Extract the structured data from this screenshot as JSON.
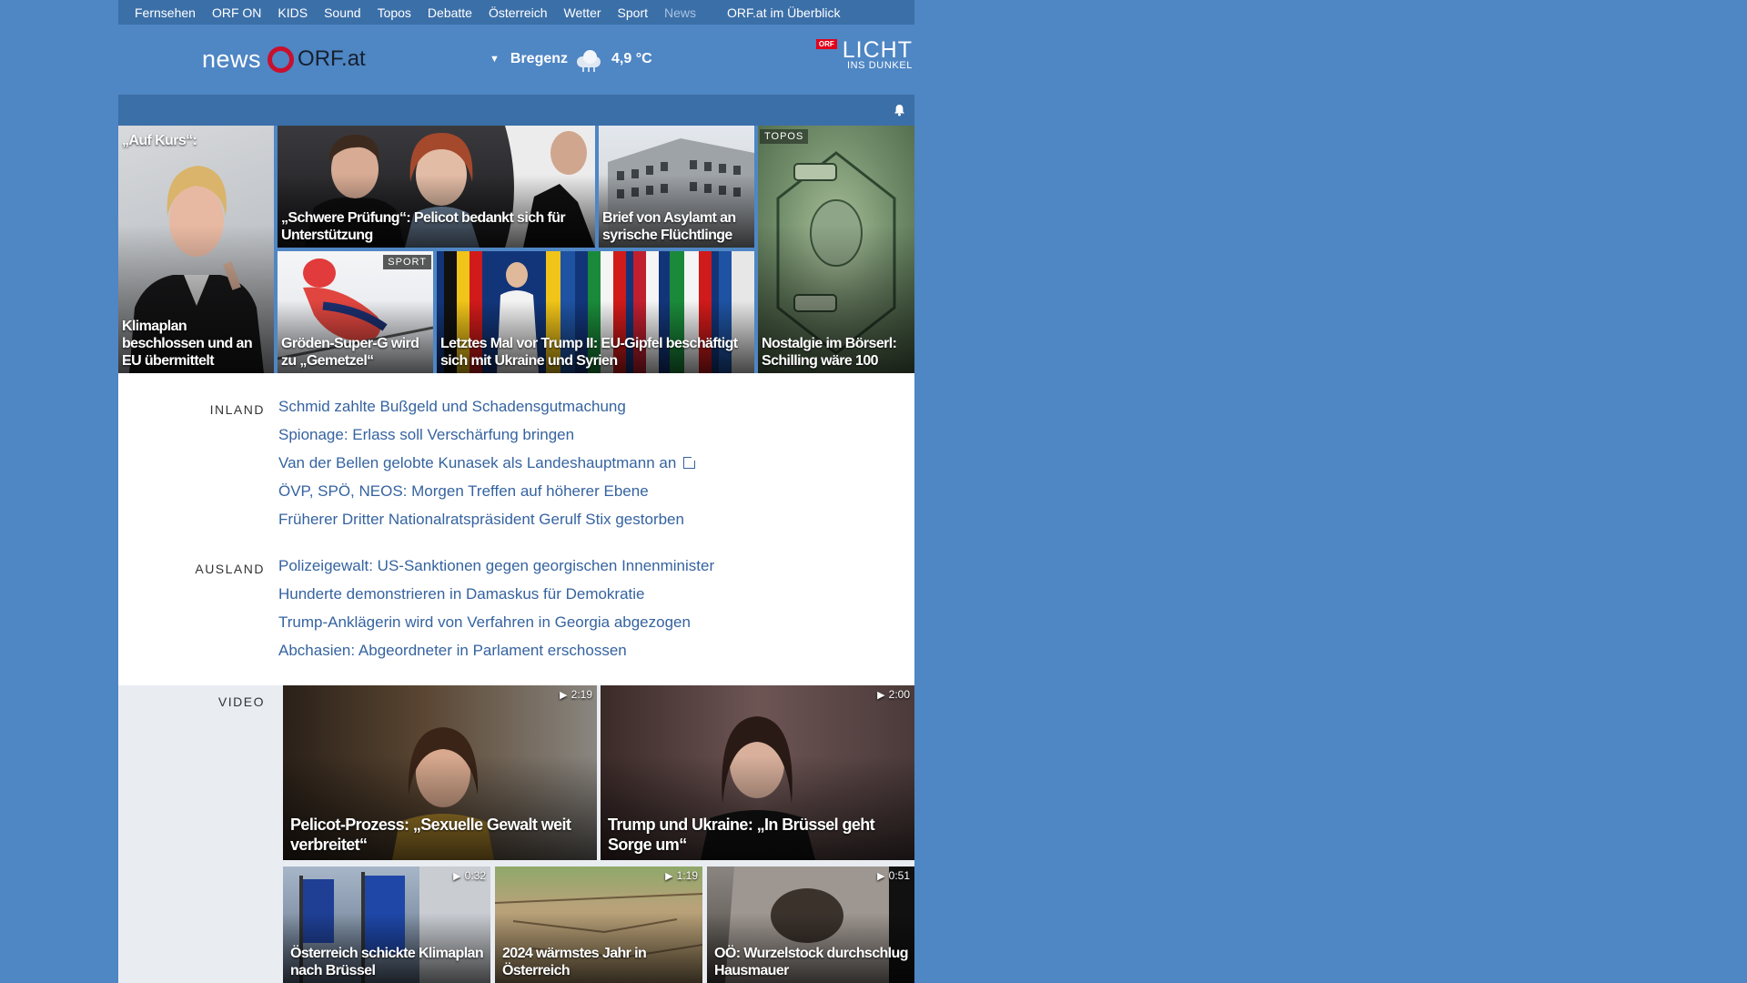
{
  "nav": {
    "items": [
      "Fernsehen",
      "ORF ON",
      "KIDS",
      "Sound",
      "Topos",
      "Debatte",
      "Österreich",
      "Wetter",
      "Sport",
      "News"
    ],
    "overview": "ORF.at im Überblick"
  },
  "header": {
    "logo_news": "news",
    "logo_orf": "ORF.at",
    "weather_city": "Bregenz",
    "weather_temp": "4,9 °C",
    "weather_icon": "cloud-rain-icon",
    "licht_badge": "ORF",
    "licht_title": "LICHT",
    "licht_sub": "INS DUNKEL"
  },
  "tiles": {
    "gewessler": "„Auf Kurs“:",
    "gewessler_bottom": "Klimaplan beschlossen und an EU übermittelt",
    "pelicot": "„Schwere Prüfung“: Pelicot bedankt sich für Unterstützung",
    "asyl": "Brief von Asylamt an syrische Flüchtlinge",
    "topos_badge": "TOPOS",
    "schilling": "Nostalgie im Börserl: Schilling wäre 100",
    "sport_badge": "SPORT",
    "groeden": "Gröden-Super-G wird zu „Gemetzel“",
    "eugipfel": "Letztes Mal vor Trump II: EU-Gipfel beschäftigt sich mit Ukraine und Syrien"
  },
  "inland": {
    "label": "INLAND",
    "items": [
      "Schmid zahlte Bußgeld und Schadensgutmachung",
      "Spionage: Erlass soll Verschärfung bringen",
      "Van der Bellen gelobte Kunasek als Landeshauptmann an",
      "ÖVP, SPÖ, NEOS: Morgen Treffen auf höherer Ebene",
      "Früherer Dritter Nationalratspräsident Gerulf Stix gestorben"
    ]
  },
  "ausland": {
    "label": "AUSLAND",
    "items": [
      "Polizeigewalt: US-Sanktionen gegen georgischen Innenminister",
      "Hunderte demonstrieren in Damaskus für Demokratie",
      "Trump-Anklägerin wird von Verfahren in Georgia abgezogen",
      "Abchasien: Abgeordneter in Parlament erschossen"
    ]
  },
  "video": {
    "label": "VIDEO",
    "items": [
      {
        "title": "Pelicot-Prozess: „Sexuelle Gewalt weit verbreitet“",
        "duration": "2:19"
      },
      {
        "title": "Trump und Ukraine: „In Brüssel geht Sorge um“",
        "duration": "2:00"
      },
      {
        "title": "Österreich schickte Klimaplan nach Brüssel",
        "duration": "0:32"
      },
      {
        "title": "2024 wärmstes Jahr in Österreich",
        "duration": "1:19"
      },
      {
        "title": "OÖ: Wurzelstock durchschlug Hausmauer",
        "duration": "0:51"
      }
    ]
  },
  "colors": {
    "background": "#4f86c4",
    "bar": "#3b6fa8",
    "link": "#3563a0",
    "orf_red": "#c8102e"
  }
}
